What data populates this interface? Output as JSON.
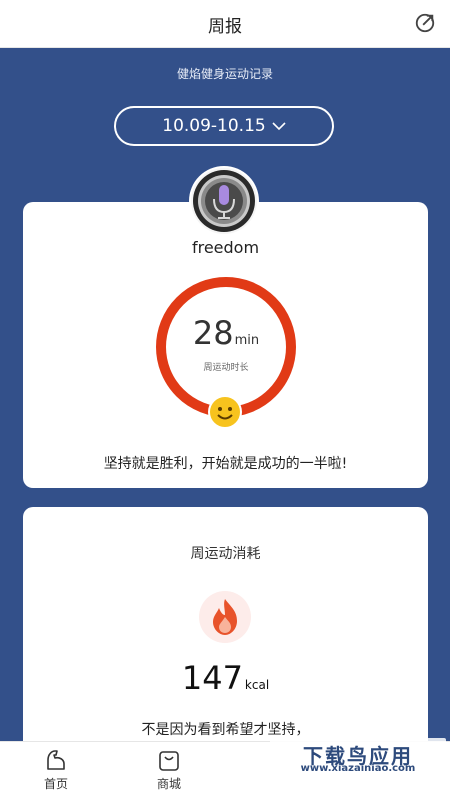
{
  "header": {
    "title": "周报"
  },
  "summary": {
    "subtitle": "健焰健身运动记录",
    "date_range": "10.09-10.15"
  },
  "profile": {
    "username": "freedom"
  },
  "duration": {
    "value": "28",
    "unit": "min",
    "label": "周运动时长",
    "motto": "坚持就是胜利，开始就是成功的一半啦!"
  },
  "calories": {
    "title": "周运动消耗",
    "value": "147",
    "unit": "kcal",
    "motto": "不是因为看到希望才坚持，"
  },
  "tabs": [
    {
      "label": "首页",
      "icon": "fitness-arm-icon"
    },
    {
      "label": "商城",
      "icon": "shopping-bag-icon"
    }
  ],
  "watermark": {
    "title": "下载鸟应用",
    "url": "www.xiazainiao.com"
  },
  "colors": {
    "background": "#33508a",
    "ring": "#e13a16",
    "smile": "#f7c31e",
    "flame": "#e8532b"
  }
}
